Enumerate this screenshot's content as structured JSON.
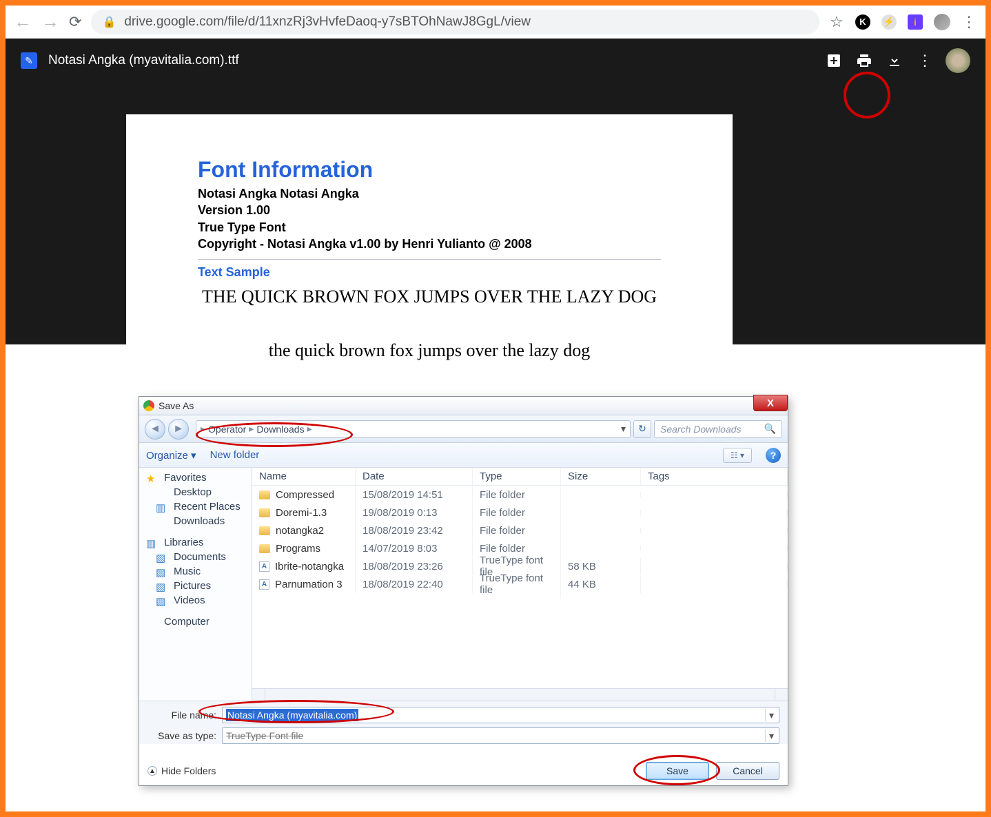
{
  "browser": {
    "url": "drive.google.com/file/d/11xnzRj3vHvfeDaoq-y7sBTOhNawJ8GgL/view"
  },
  "drive": {
    "filename": "Notasi Angka (myavitalia.com).ttf"
  },
  "preview": {
    "heading": "Font Information",
    "meta1": "Notasi Angka Notasi Angka",
    "meta2": "Version 1.00",
    "meta3": "True Type Font",
    "meta4": "Copyright - Notasi Angka v1.00 by Henri Yulianto @ 2008",
    "sample_h": "Text Sample",
    "sample_upper": "THE QUICK BROWN FOX JUMPS OVER THE LAZY DOG",
    "sample_lower": "the quick brown fox jumps over the lazy dog"
  },
  "dialog": {
    "title": "Save As",
    "crumb1": "Operator",
    "crumb2": "Downloads",
    "search_placeholder": "Search Downloads",
    "organize": "Organize",
    "newfolder": "New folder",
    "nav": {
      "favorites": "Favorites",
      "desktop": "Desktop",
      "recent": "Recent Places",
      "downloads": "Downloads",
      "libraries": "Libraries",
      "documents": "Documents",
      "music": "Music",
      "pictures": "Pictures",
      "videos": "Videos",
      "computer": "Computer"
    },
    "cols": {
      "name": "Name",
      "date": "Date",
      "type": "Type",
      "size": "Size",
      "tags": "Tags"
    },
    "rows": [
      {
        "name": "Compressed",
        "date": "15/08/2019 14:51",
        "type": "File folder",
        "size": "",
        "kind": "folder"
      },
      {
        "name": "Doremi-1.3",
        "date": "19/08/2019 0:13",
        "type": "File folder",
        "size": "",
        "kind": "folder"
      },
      {
        "name": "notangka2",
        "date": "18/08/2019 23:42",
        "type": "File folder",
        "size": "",
        "kind": "folder"
      },
      {
        "name": "Programs",
        "date": "14/07/2019 8:03",
        "type": "File folder",
        "size": "",
        "kind": "folder"
      },
      {
        "name": "Ibrite-notangka",
        "date": "18/08/2019 23:26",
        "type": "TrueType font file",
        "size": "58 KB",
        "kind": "font"
      },
      {
        "name": "Parnumation 3",
        "date": "18/08/2019 22:40",
        "type": "TrueType font file",
        "size": "44 KB",
        "kind": "font"
      }
    ],
    "filename_label": "File name:",
    "filename_value": "Notasi Angka (myavitalia.com)",
    "savetype_label": "Save as type:",
    "savetype_value": "TrueType Font file",
    "hide_folders": "Hide Folders",
    "save": "Save",
    "cancel": "Cancel"
  }
}
